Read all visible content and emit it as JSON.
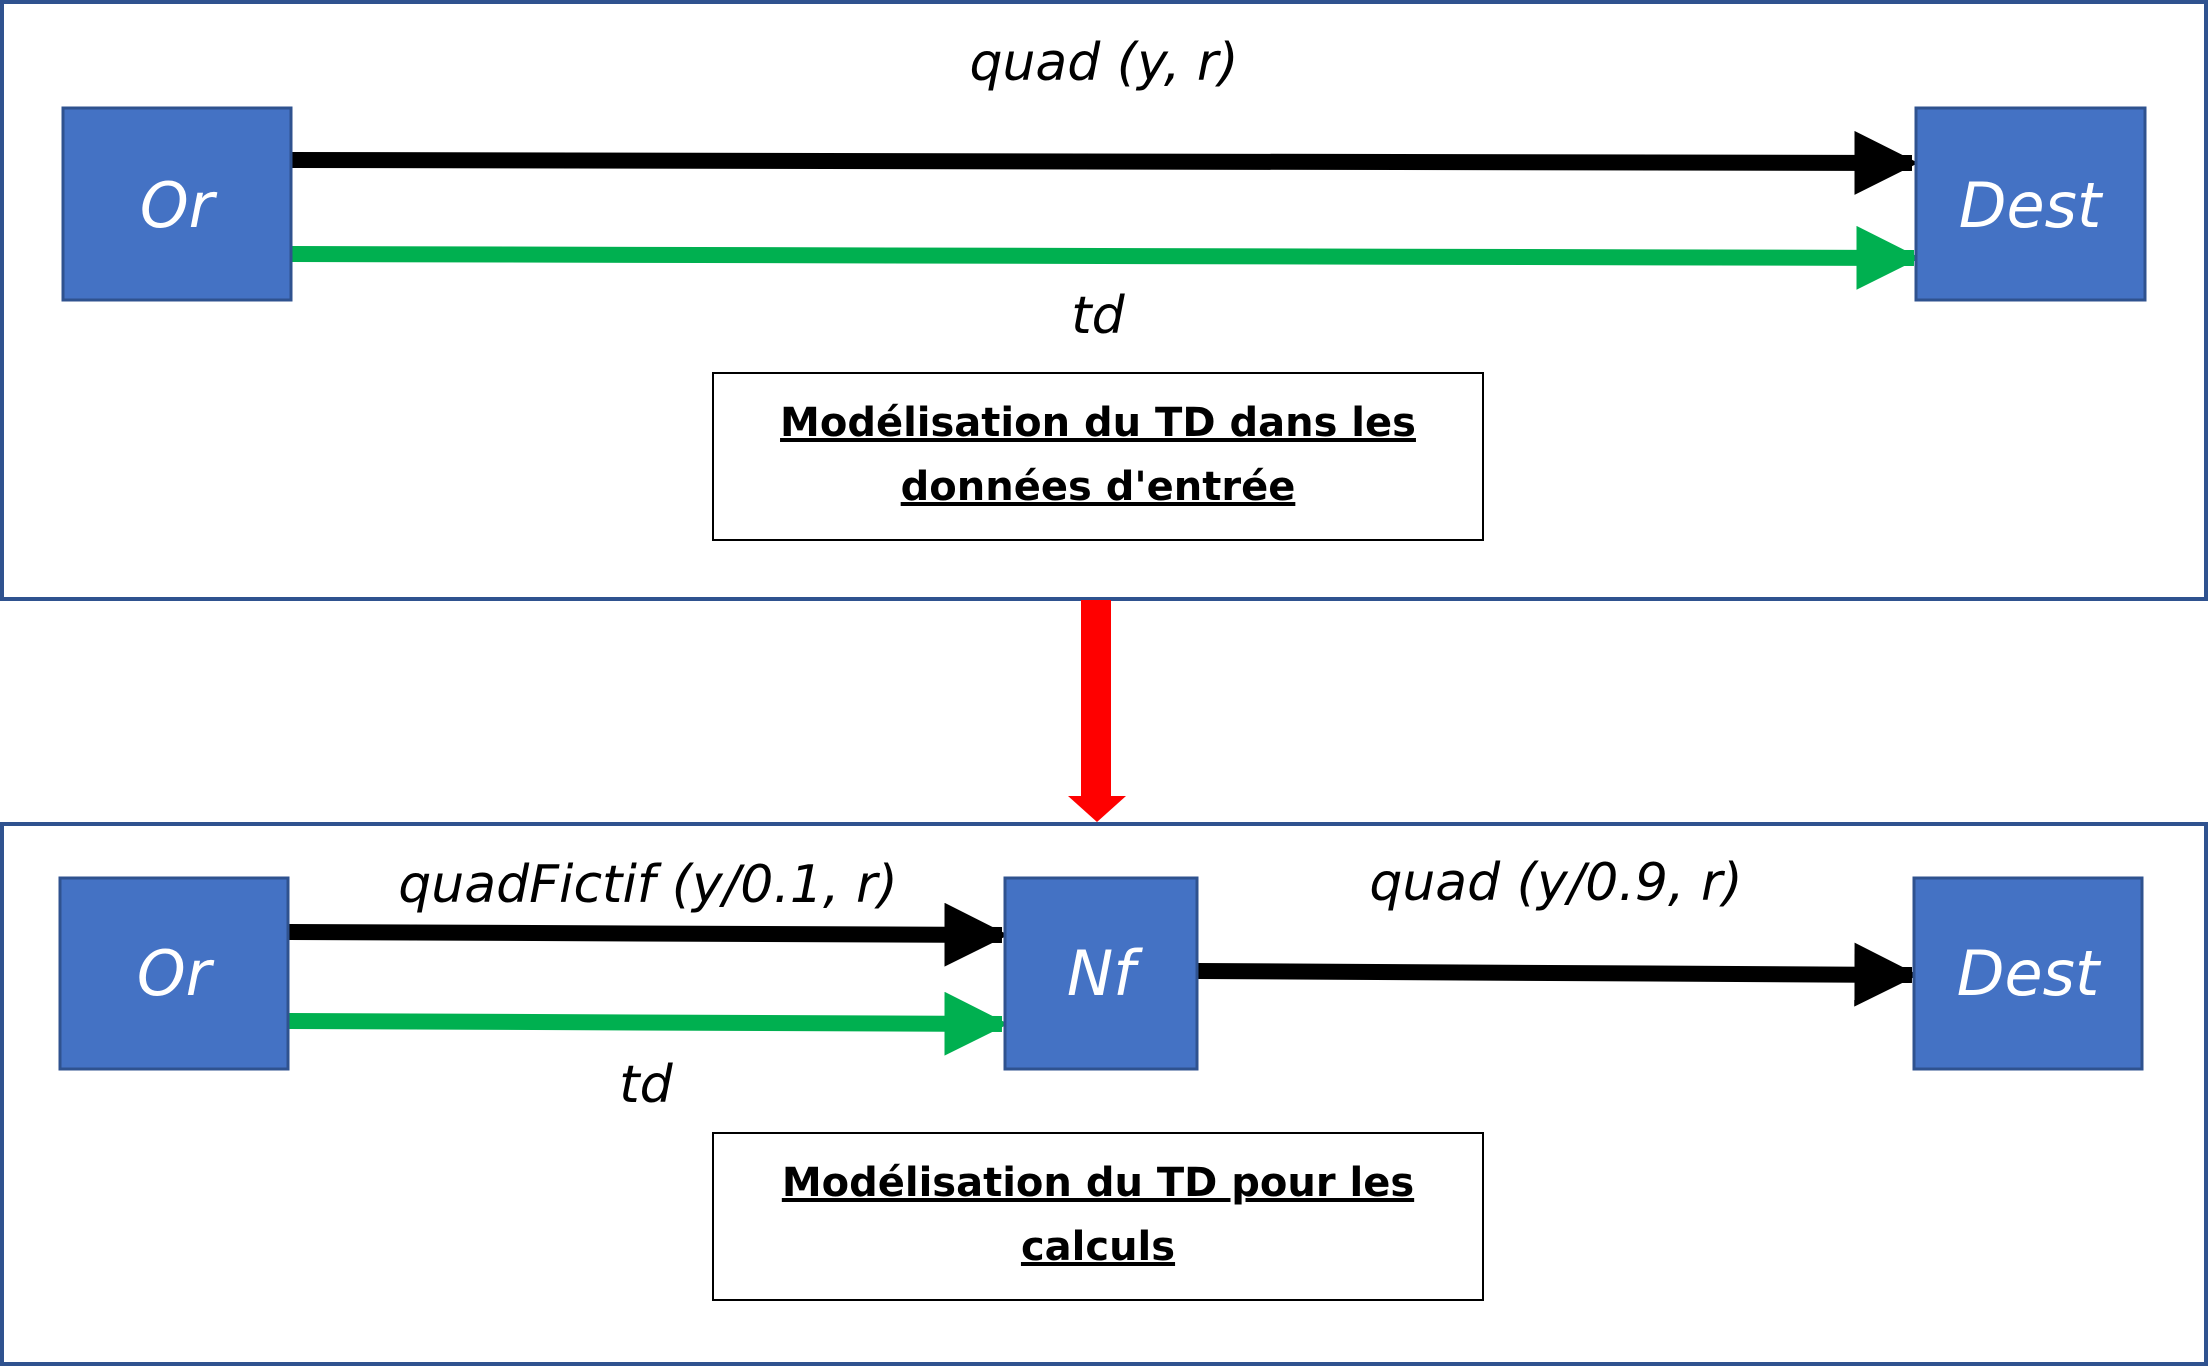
{
  "colors": {
    "node_fill": "#4472C4",
    "node_border": "#2F528F",
    "panel_border": "#2F528F",
    "main_arrow": "#000000",
    "td_arrow": "#00B050",
    "transition_arrow": "#FF0000"
  },
  "top": {
    "origin": "Or",
    "destination": "Dest",
    "edge_quad": "quad (y, r)",
    "edge_td": "td",
    "caption_line1": "Modélisation du TD dans les",
    "caption_line2": "données d'entrée"
  },
  "bottom": {
    "origin": "Or",
    "intermediate": "Nf",
    "destination": "Dest",
    "edge_quadfictif": "quadFictif (y/0.1, r)",
    "edge_quad": "quad (y/0.9, r)",
    "edge_td": "td",
    "caption_line1": "Modélisation du TD pour les",
    "caption_line2": "calculs"
  }
}
